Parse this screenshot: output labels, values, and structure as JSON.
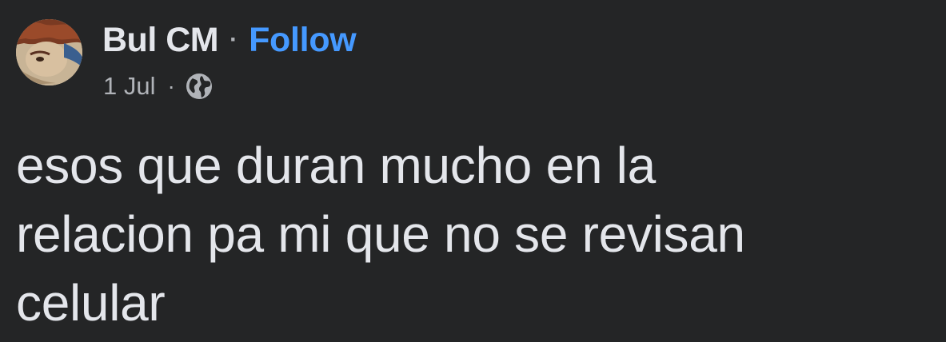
{
  "post": {
    "author": "Bul CM",
    "separator": "·",
    "follow_label": "Follow",
    "date": "1 Jul",
    "meta_separator": "·",
    "audience_icon": "globe-icon",
    "text_lines": [
      "esos que duran mucho en la",
      "relacion pa mi que no se revisan",
      "celular"
    ]
  },
  "colors": {
    "background": "#242526",
    "primary_text": "#e4e6eb",
    "secondary_text": "#b0b3b8",
    "link": "#4599ff"
  }
}
